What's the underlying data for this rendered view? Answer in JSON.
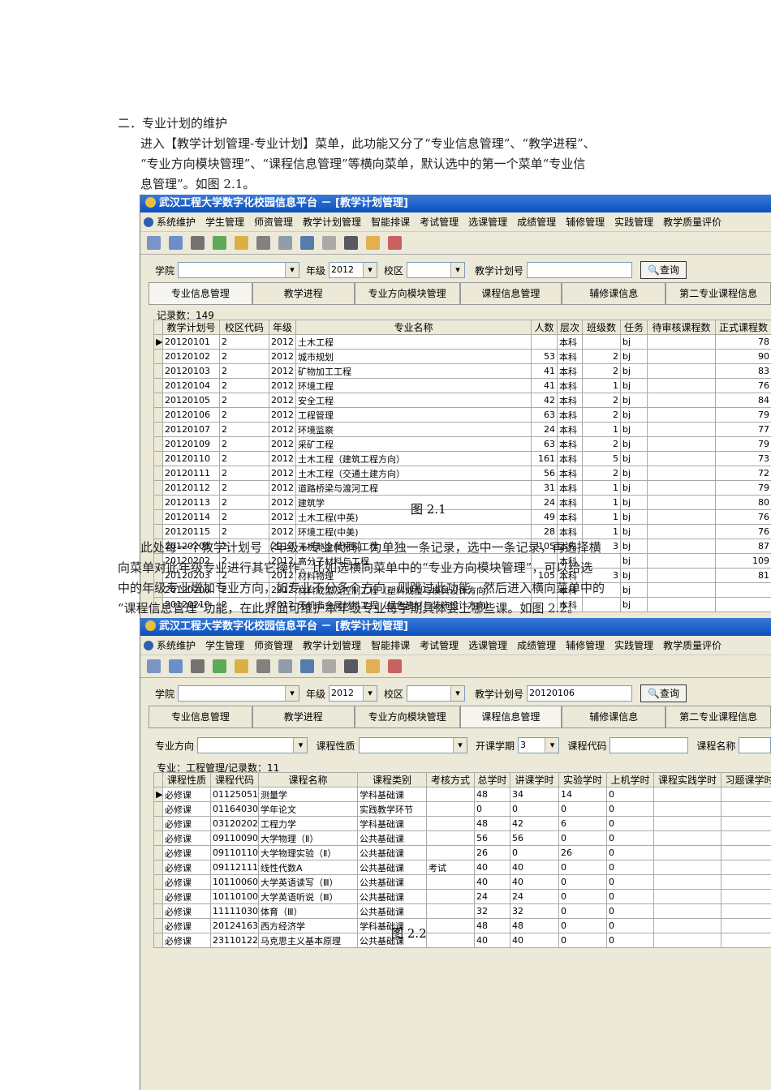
{
  "doc": {
    "heading": "二．专业计划的维护",
    "para1": [
      "进入【教学计划管理-专业计划】菜单，此功能又分了“专业信息管理”、“教学进程”、",
      "“专业方向模块管理”、“课程信息管理”等横向菜单，默认选中的第一个菜单“专业信",
      "息管理”。如图 2.1。"
    ],
    "para2": [
      "此处每一个教学计划号（年级+专业代码）为单独一条记录，选中一条记录，再选择横",
      "向菜单对此年级专业进行其它操作。比如选横向菜单中的“专业方向模块管理”，可以给选",
      "中的年级专业增加专业方向，如专业不分多个方向，则跳过此功能。然后进入横向菜单中的",
      "“课程信息管理”功能，在此界面可维护本年级专业每学期具体要上哪些课。如图 2.2。"
    ],
    "fig1": "图 2.1",
    "fig2": "图 2.2"
  },
  "app": {
    "title": "武汉工程大学数字化校园信息平台 － [教学计划管理]",
    "menu": [
      "系统维护",
      "学生管理",
      "师资管理",
      "教学计划管理",
      "智能排课",
      "考试管理",
      "选课管理",
      "成绩管理",
      "辅修管理",
      "实践管理",
      "教学质量评价"
    ],
    "tabs": [
      "专业信息管理",
      "教学进程",
      "专业方向模块管理",
      "课程信息管理",
      "辅修课信息",
      "第二专业课程信息"
    ],
    "filter": {
      "college_label": "学院",
      "college": "",
      "grade_label": "年级",
      "grade": "2012",
      "campus_label": "校区",
      "campus": "",
      "plan_label": "教学计划号",
      "query": "查询"
    }
  },
  "win1": {
    "plan_value": "",
    "records": "记录数：149",
    "headers": [
      "教学计划号",
      "校区代码",
      "年级",
      "专业名称",
      "人数",
      "层次",
      "班级数",
      "任务",
      "待审核课程数",
      "正式课程数"
    ],
    "rows": [
      [
        "20120101",
        "2",
        "2012",
        "土木工程",
        "",
        "本科",
        "",
        "bj",
        "",
        "78"
      ],
      [
        "20120102",
        "2",
        "2012",
        "城市规划",
        "53",
        "本科",
        "2",
        "bj",
        "",
        "90"
      ],
      [
        "20120103",
        "2",
        "2012",
        "矿物加工工程",
        "41",
        "本科",
        "2",
        "bj",
        "",
        "83"
      ],
      [
        "20120104",
        "2",
        "2012",
        "环境工程",
        "41",
        "本科",
        "1",
        "bj",
        "",
        "76"
      ],
      [
        "20120105",
        "2",
        "2012",
        "安全工程",
        "42",
        "本科",
        "2",
        "bj",
        "",
        "84"
      ],
      [
        "20120106",
        "2",
        "2012",
        "工程管理",
        "63",
        "本科",
        "2",
        "bj",
        "",
        "79"
      ],
      [
        "20120107",
        "2",
        "2012",
        "环境监察",
        "24",
        "本科",
        "1",
        "bj",
        "",
        "77"
      ],
      [
        "20120109",
        "2",
        "2012",
        "采矿工程",
        "63",
        "本科",
        "2",
        "bj",
        "",
        "79"
      ],
      [
        "20120110",
        "2",
        "2012",
        "土木工程（建筑工程方向）",
        "161",
        "本科",
        "5",
        "bj",
        "",
        "73"
      ],
      [
        "20120111",
        "2",
        "2012",
        "土木工程（交通土建方向）",
        "56",
        "本科",
        "2",
        "bj",
        "",
        "72"
      ],
      [
        "20120112",
        "2",
        "2012",
        "道路桥梁与渡河工程",
        "31",
        "本科",
        "1",
        "bj",
        "",
        "79"
      ],
      [
        "20120113",
        "2",
        "2012",
        "建筑学",
        "24",
        "本科",
        "1",
        "bj",
        "",
        "80"
      ],
      [
        "20120114",
        "2",
        "2012",
        "土木工程(中英)",
        "49",
        "本科",
        "1",
        "bj",
        "",
        "76"
      ],
      [
        "20120115",
        "2",
        "2012",
        "环境工程(中美)",
        "28",
        "本科",
        "1",
        "bj",
        "",
        "76"
      ],
      [
        "20120201",
        "2",
        "2012",
        "无机非金属材料工程",
        "105",
        "本科",
        "3",
        "bj",
        "",
        "87"
      ],
      [
        "20120202",
        "2",
        "2012",
        "高分子材料与工程",
        "",
        "本科",
        "",
        "bj",
        "",
        "109"
      ],
      [
        "20120203",
        "2",
        "2012",
        "材料物理",
        "105",
        "本科",
        "3",
        "bj",
        "",
        "81"
      ],
      [
        "20120206",
        "2",
        "2012",
        "材料成型及控制工程（塑料成型与模具设计方向）",
        "",
        "本科",
        "",
        "bj",
        "",
        ""
      ],
      [
        "20120210",
        "2",
        "2012",
        "无机非金属材料工程（绿色建材与装饰设计方向）",
        "",
        "本科",
        "",
        "bj",
        "",
        ""
      ]
    ]
  },
  "win2": {
    "plan_value": "20120106",
    "filter2": {
      "dir_label": "专业方向",
      "nature_label": "课程性质",
      "term_label": "开课学期",
      "term": "3",
      "code_label": "课程代码",
      "name_label": "课程名称"
    },
    "records": "专业：工程管理/记录数：11",
    "headers": [
      "课程性质",
      "课程代码",
      "课程名称",
      "课程类别",
      "考核方式",
      "总学时",
      "讲课学时",
      "实验学时",
      "上机学时",
      "课程实践学时",
      "习题课学时"
    ],
    "rows": [
      [
        "必修课",
        "01125051",
        "测量学",
        "学科基础课",
        "",
        "48",
        "34",
        "14",
        "0",
        "",
        ""
      ],
      [
        "必修课",
        "01164030",
        "学年论文",
        "实践教学环节",
        "",
        "0",
        "0",
        "0",
        "0",
        "",
        ""
      ],
      [
        "必修课",
        "03120202",
        "工程力学",
        "学科基础课",
        "",
        "48",
        "42",
        "6",
        "0",
        "",
        ""
      ],
      [
        "必修课",
        "09110090",
        "大学物理（Ⅱ）",
        "公共基础课",
        "",
        "56",
        "56",
        "0",
        "0",
        "",
        ""
      ],
      [
        "必修课",
        "09110110",
        "大学物理实验（Ⅱ）",
        "公共基础课",
        "",
        "26",
        "0",
        "26",
        "0",
        "",
        ""
      ],
      [
        "必修课",
        "09112111",
        "线性代数A",
        "公共基础课",
        "考试",
        "40",
        "40",
        "0",
        "0",
        "",
        ""
      ],
      [
        "必修课",
        "10110060",
        "大学英语读写（Ⅲ）",
        "公共基础课",
        "",
        "40",
        "40",
        "0",
        "0",
        "",
        ""
      ],
      [
        "必修课",
        "10110100",
        "大学英语听说（Ⅲ）",
        "公共基础课",
        "",
        "24",
        "24",
        "0",
        "0",
        "",
        ""
      ],
      [
        "必修课",
        "11111030",
        "体育（Ⅲ）",
        "公共基础课",
        "",
        "32",
        "32",
        "0",
        "0",
        "",
        ""
      ],
      [
        "必修课",
        "20124163",
        "西方经济学",
        "学科基础课",
        "",
        "48",
        "48",
        "0",
        "0",
        "",
        ""
      ],
      [
        "必修课",
        "23110122",
        "马克思主义基本原理",
        "公共基础课",
        "",
        "40",
        "40",
        "0",
        "0",
        "",
        ""
      ]
    ]
  }
}
